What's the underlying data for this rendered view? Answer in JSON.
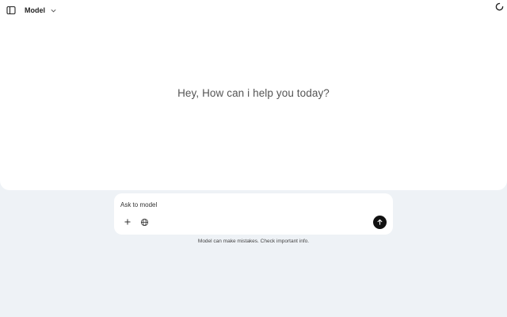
{
  "header": {
    "model_label": "Model",
    "icons": {
      "sidebar": "sidebar-toggle-icon",
      "chevron": "chevron-down-icon",
      "loading": "loading-spinner-icon"
    }
  },
  "main": {
    "greeting": "Hey, How can i help you today?"
  },
  "composer": {
    "placeholder": "Ask to model",
    "icons": {
      "attach": "plus-icon",
      "web": "globe-icon",
      "send": "arrow-up-icon"
    }
  },
  "footer": {
    "disclaimer": "Model can make mistakes. Check important info."
  }
}
